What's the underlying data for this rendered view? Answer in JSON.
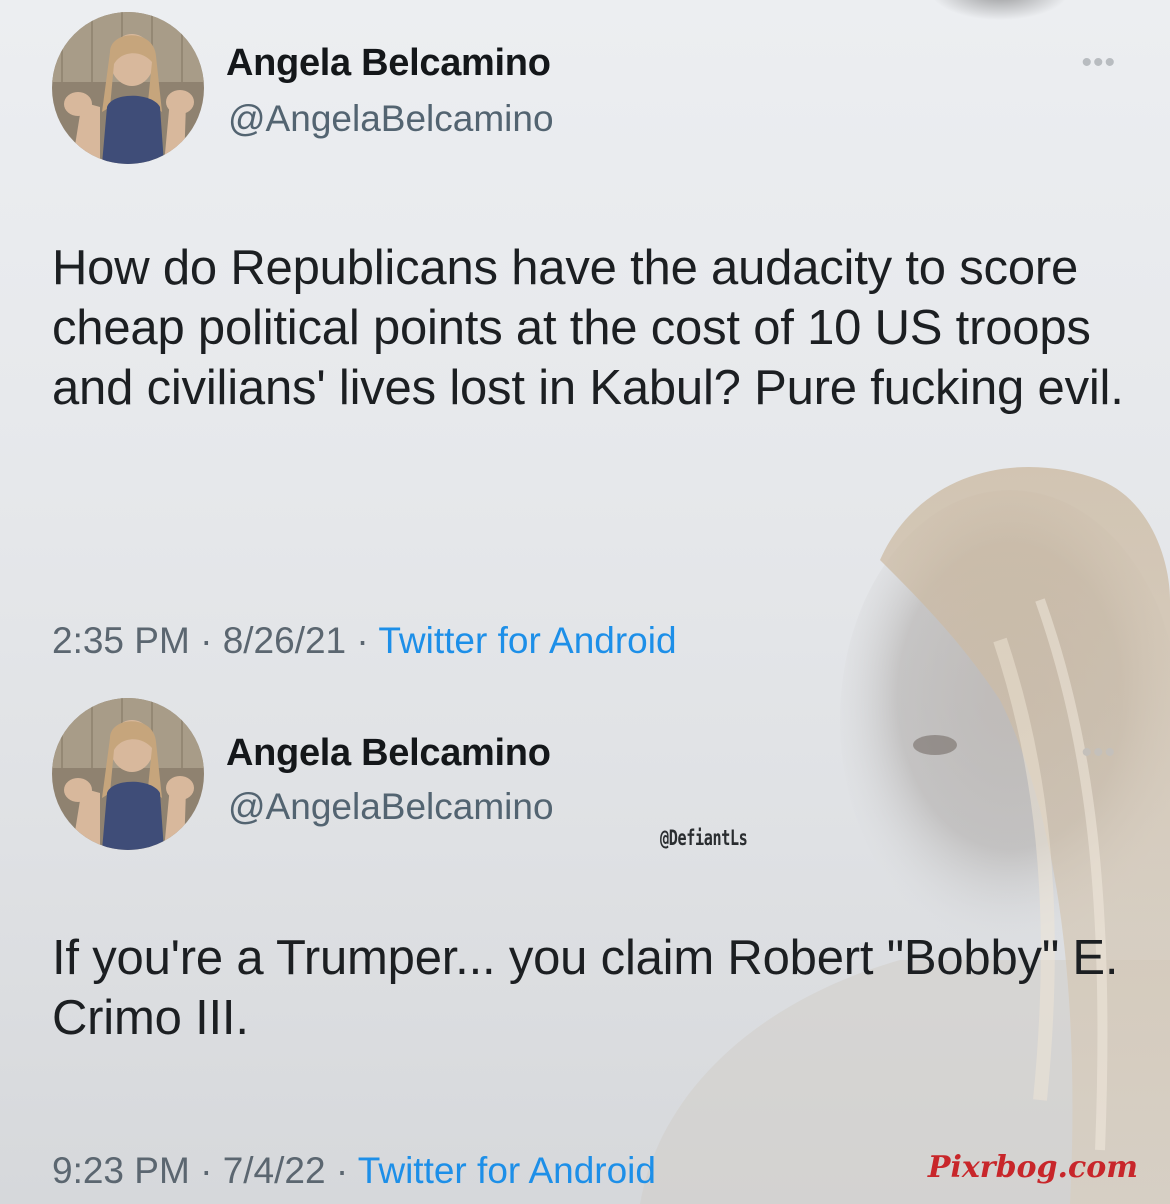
{
  "tweets": [
    {
      "display_name": "Angela Belcamino",
      "handle": "@AngelaBelcamino",
      "text": "How do Republicans have the audacity to score cheap political points at the cost of 10 US troops and civilians' lives lost in Kabul? Pure fucking evil.",
      "time": "2:35 PM",
      "date": "8/26/21",
      "source": "Twitter for Android"
    },
    {
      "display_name": "Angela Belcamino",
      "handle": "@AngelaBelcamino",
      "text": "If you're a Trumper... you claim Robert \"Bobby\" E. Crimo III.",
      "time": "9:23 PM",
      "date": "7/4/22",
      "source": "Twitter for Android"
    }
  ],
  "watermarks": {
    "handle": "@DefiantLs",
    "site": "Pixrbog.com"
  },
  "icons": {
    "more": "more-options-icon",
    "separator": "·"
  },
  "colors": {
    "source_link": "#1d8fe8",
    "watermark_site": "#c8262a"
  }
}
